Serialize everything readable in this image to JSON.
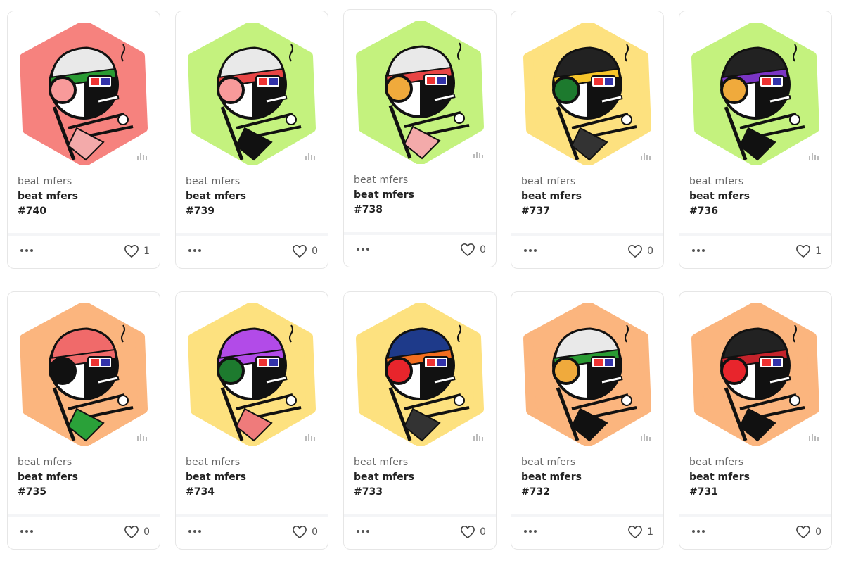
{
  "cards": [
    {
      "collection": "beat mfers",
      "name": "beat mfers",
      "number": "#740",
      "likes": "1",
      "bg": "#f6827e",
      "hat": "#e9e9e9",
      "band": "#2a9b33",
      "phone": "#f89a9a",
      "shirt": "#f3aaaa"
    },
    {
      "collection": "beat mfers",
      "name": "beat mfers",
      "number": "#739",
      "likes": "0",
      "bg": "#c4f27e",
      "hat": "#e9e9e9",
      "band": "#e84545",
      "phone": "#f89a9a",
      "shirt": "#111111"
    },
    {
      "collection": "beat mfers",
      "name": "beat mfers",
      "number": "#738",
      "likes": "0",
      "bg": "#c4f27e",
      "hat": "#e9e9e9",
      "band": "#e84545",
      "phone": "#f0aa3c",
      "shirt": "#f3aaaa"
    },
    {
      "collection": "beat mfers",
      "name": "beat mfers",
      "number": "#737",
      "likes": "0",
      "bg": "#fde17f",
      "hat": "#222222",
      "band": "#f6c52b",
      "phone": "#1d7a2e",
      "shirt": "#333333"
    },
    {
      "collection": "beat mfers",
      "name": "beat mfers",
      "number": "#736",
      "likes": "1",
      "bg": "#c4f27e",
      "hat": "#222222",
      "band": "#7b35c5",
      "phone": "#f0aa3c",
      "shirt": "#111111"
    },
    {
      "collection": "beat mfers",
      "name": "beat mfers",
      "number": "#735",
      "likes": "0",
      "bg": "#fbb57e",
      "hat": "#f06a6a",
      "band": "#f06a6a",
      "phone": "#111111",
      "shirt": "#2aa139"
    },
    {
      "collection": "beat mfers",
      "name": "beat mfers",
      "number": "#734",
      "likes": "0",
      "bg": "#fde17f",
      "hat": "#b24be8",
      "band": "#b24be8",
      "phone": "#1d7a2e",
      "shirt": "#ef7b7b"
    },
    {
      "collection": "beat mfers",
      "name": "beat mfers",
      "number": "#733",
      "likes": "0",
      "bg": "#fde17f",
      "hat": "#1e3a8a",
      "band": "#f36d1f",
      "phone": "#e8252c",
      "shirt": "#333333"
    },
    {
      "collection": "beat mfers",
      "name": "beat mfers",
      "number": "#732",
      "likes": "1",
      "bg": "#fbb57e",
      "hat": "#e9e9e9",
      "band": "#2a9b33",
      "phone": "#f0aa3c",
      "shirt": "#111111"
    },
    {
      "collection": "beat mfers",
      "name": "beat mfers",
      "number": "#731",
      "likes": "0",
      "bg": "#fbb57e",
      "hat": "#222222",
      "band": "#c4232b",
      "phone": "#e8252c",
      "shirt": "#111111"
    }
  ],
  "more_icon": "more-horizontal-icon",
  "heart_icon": "heart-outline-icon"
}
